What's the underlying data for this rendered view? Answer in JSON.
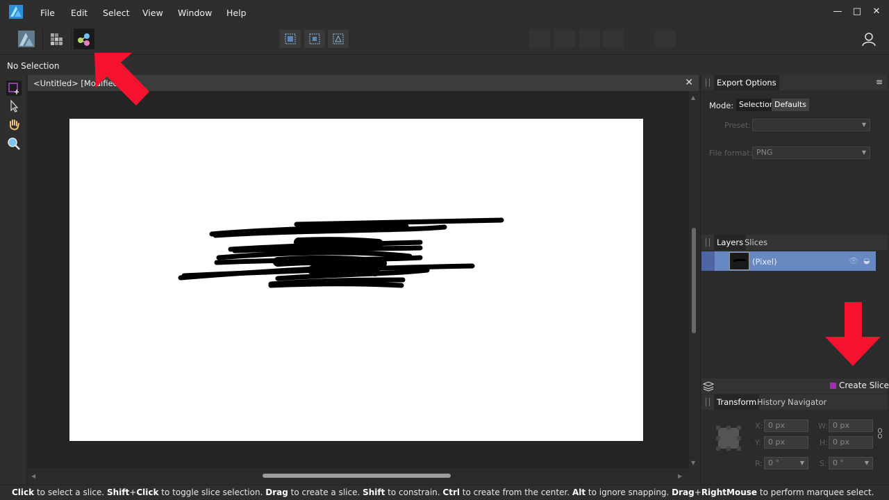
{
  "menu": {
    "items": [
      "File",
      "Edit",
      "Select",
      "View",
      "Window",
      "Help"
    ]
  },
  "window_controls": {
    "minimize": "—",
    "maximize": "□",
    "close": "✕"
  },
  "context": {
    "selection_text": "No Selection"
  },
  "document": {
    "tab_title": "<Untitled> [Modified] (",
    "close_glyph": "✕"
  },
  "export_options": {
    "panel_title": "Export Options",
    "mode_label": "Mode:",
    "mode_selection": "Selection",
    "mode_defaults": "Defaults",
    "preset_label": "Preset:",
    "preset_value": "",
    "file_format_label": "File format:",
    "file_format_value": "PNG"
  },
  "layers_panel": {
    "tab_layers": "Layers",
    "tab_slices": "Slices",
    "layer_name": "(Pixel)"
  },
  "slices": {
    "create_slice_label": "Create Slice"
  },
  "transform_panel": {
    "tab_transform": "Transform",
    "tab_history": "History",
    "tab_navigator": "Navigator",
    "x_label": "X:",
    "y_label": "Y:",
    "w_label": "W:",
    "h_label": "H:",
    "r_label": "R:",
    "s_label": "S:",
    "x_value": "0 px",
    "y_value": "0 px",
    "w_value": "0 px",
    "h_value": "0 px",
    "r_value": "0 °",
    "s_value": "0 °"
  },
  "status": {
    "s1": "Click",
    "t1": " to select a slice. ",
    "s2": "Shift",
    "t2": "+",
    "s3": "Click",
    "t3": " to toggle slice selection. ",
    "s4": "Drag",
    "t4": " to create a slice. ",
    "s5": "Shift",
    "t5": " to constrain. ",
    "s6": "Ctrl",
    "t6": " to create from the center. ",
    "s7": "Alt",
    "t7": " to ignore snapping. ",
    "s8": "Drag",
    "t8": "+",
    "s9": "RightMouse",
    "t9": " to perform marquee select."
  },
  "colors": {
    "accent_purple": "#a02db8",
    "selection_blue": "#6888c2",
    "annotation_red": "#f5122e",
    "logo_blue": "#3aa5e8"
  }
}
